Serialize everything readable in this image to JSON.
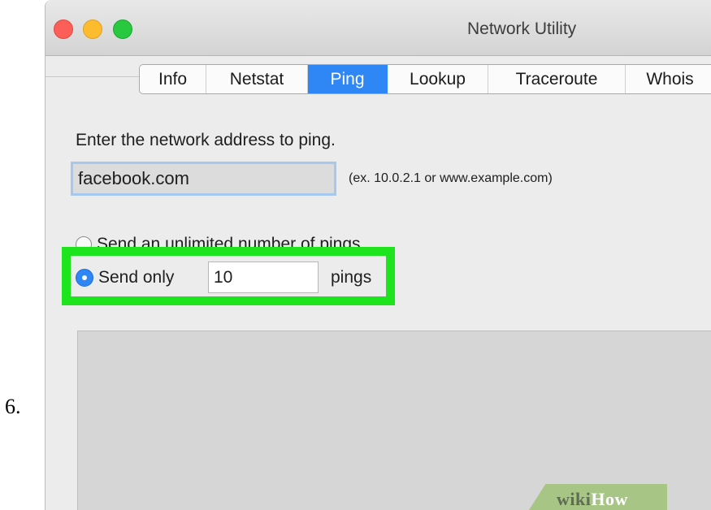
{
  "step_number": "6.",
  "window": {
    "title": "Network Utility",
    "tabs": [
      {
        "label": "Info",
        "active": false
      },
      {
        "label": "Netstat",
        "active": false
      },
      {
        "label": "Ping",
        "active": true
      },
      {
        "label": "Lookup",
        "active": false
      },
      {
        "label": "Traceroute",
        "active": false
      },
      {
        "label": "Whois",
        "active": false
      }
    ]
  },
  "ping": {
    "prompt": "Enter the network address to ping.",
    "address_value": "facebook.com",
    "address_hint": "(ex. 10.0.2.1 or www.example.com)",
    "unlimited_label": "Send an unlimited number of pings",
    "send_only_label": "Send only",
    "count_value": "10",
    "pings_label": "pings"
  },
  "watermark": {
    "part_a": "wiki",
    "part_b": "How"
  },
  "colors": {
    "accent": "#2f86f5",
    "highlight": "#1ee41e"
  }
}
